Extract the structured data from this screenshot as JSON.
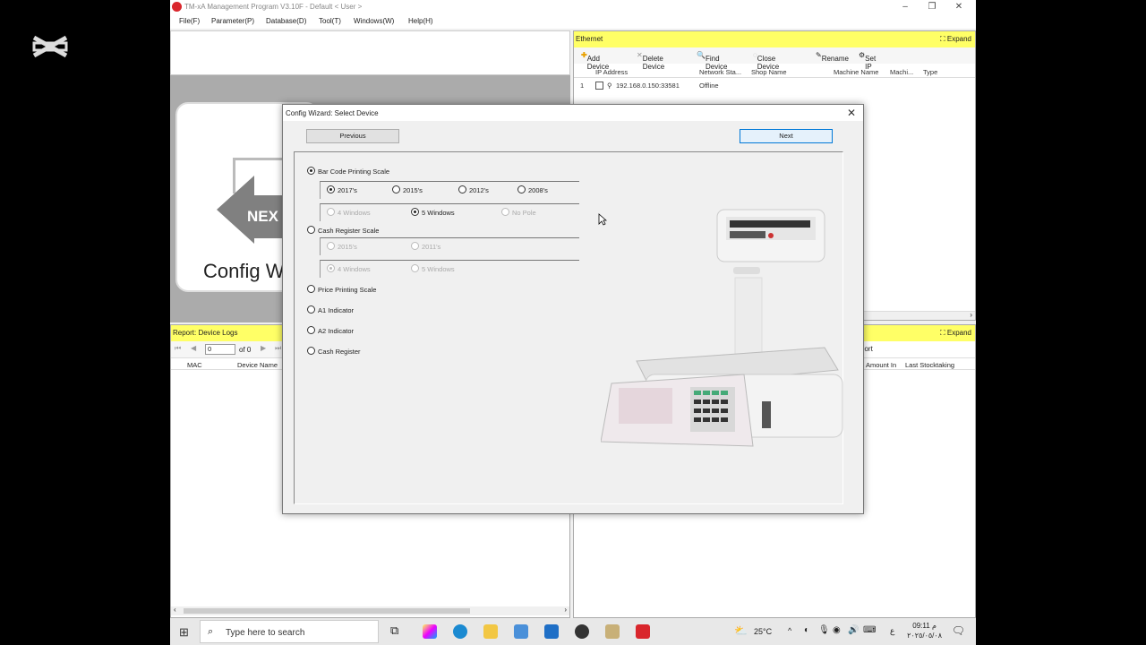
{
  "window": {
    "title": "TM-xA Management Program V3.10F - Default < User >"
  },
  "menu": [
    "File(F)",
    "Parameter(P)",
    "Database(D)",
    "Tool(T)",
    "Windows(W)",
    "Help(H)"
  ],
  "background_card": {
    "next_text": "NEX",
    "config_text": "Config W"
  },
  "ethernet": {
    "title": "Ethernet",
    "expand": "Expand",
    "toolbar": {
      "add": "Add Device",
      "delete": "Delete Device",
      "find": "Find Device",
      "close": "Close Device",
      "rename": "Rename",
      "setip": "Set IP"
    },
    "columns": [
      "IP Address",
      "Network Sta...",
      "Shop Name",
      "Machine Name",
      "Machi...",
      "Type"
    ],
    "rows": [
      {
        "num": "1",
        "ip": "192.168.0.150:33581",
        "status": "Offline"
      }
    ]
  },
  "report": {
    "title": "Report: Device Logs",
    "page_value": "0",
    "page_of": "of 0",
    "columns": [
      "MAC",
      "Device Name"
    ]
  },
  "report2": {
    "expand": "Expand",
    "partial_label": "port",
    "columns": [
      "Amount In",
      "Last Stocktaking"
    ]
  },
  "dialog": {
    "title": "Config Wizard: Select Device",
    "prev": "Previous",
    "next": "Next",
    "options": {
      "barcode": "Bar Code Printing Scale",
      "barcode_years": [
        "2017's",
        "2015's",
        "2012's",
        "2008's"
      ],
      "barcode_windows": [
        "4 Windows",
        "5 Windows",
        "No Pole"
      ],
      "cash_scale": "Cash Register Scale",
      "cash_years": [
        "2015's",
        "2011's"
      ],
      "cash_windows": [
        "4 Windows",
        "5 Windows"
      ],
      "price": "Price Printing Scale",
      "a1": "A1 Indicator",
      "a2": "A2 Indicator",
      "cash_register": "Cash Register"
    }
  },
  "taskbar": {
    "search_placeholder": "Type here to search",
    "temperature": "25°C",
    "time": "09:11 م",
    "date": "٢٠٢٥/٠٥/٠٨",
    "lang": "ع"
  }
}
